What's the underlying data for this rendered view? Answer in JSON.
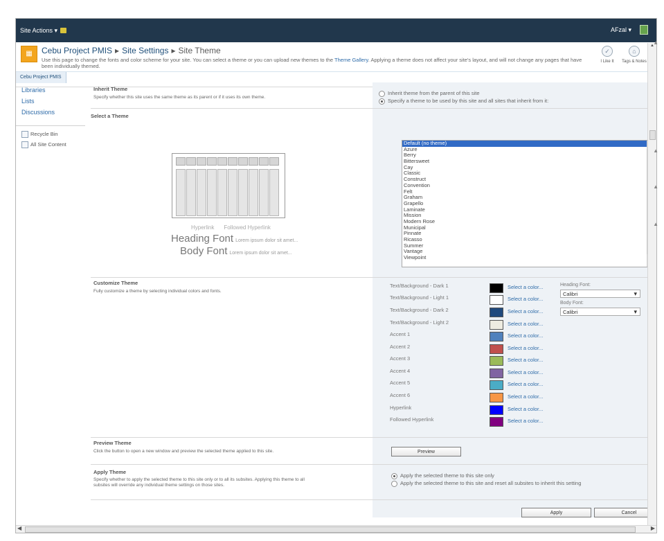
{
  "topbar": {
    "site_actions": "Site Actions ▾",
    "user": "AFzal ▾"
  },
  "header": {
    "breadcrumb": [
      "Cebu Project PMIS",
      "Site Settings",
      "Site Theme"
    ],
    "description_before": "Use this page to change the fonts and color scheme for your site. You can select a theme or you can upload new themes to the ",
    "gallery_link": "Theme Gallery",
    "description_after": ". Applying a theme does not affect your site's layout, and will not change any pages that have been individually themed.",
    "like_label": "I Like It",
    "tags_label": "Tags & Notes",
    "tab": "Cebu Project PMIS"
  },
  "sidebar": {
    "links": [
      "Libraries",
      "Lists",
      "Discussions"
    ],
    "utilities": [
      "Recycle Bin",
      "All Site Content"
    ]
  },
  "sections": {
    "inherit": {
      "title": "Inherit Theme",
      "desc": "Specify whether this site uses the same theme as its parent or if it uses its own theme.",
      "options": [
        "Inherit theme from the parent of this site",
        "Specify a theme to be used by this site and all sites that inherit from it:"
      ]
    },
    "select": {
      "title": "Select a Theme",
      "themes": [
        "Default (no theme)",
        "Azure",
        "Berry",
        "Bittersweet",
        "Cay",
        "Classic",
        "Construct",
        "Convention",
        "Felt",
        "Graham",
        "Grapello",
        "Laminate",
        "Mission",
        "Modern Rose",
        "Municipal",
        "Pinnate",
        "Ricasso",
        "Summer",
        "Vantage",
        "Viewpoint"
      ],
      "preview_hyperlink": "Hyperlink",
      "preview_followed": "Followed Hyperlink",
      "heading_font": "Heading Font",
      "body_font": "Body Font",
      "lorem": "Lorem ipsum dolor sit amet..."
    },
    "customize": {
      "title": "Customize Theme",
      "desc": "Fully customize a theme by selecting individual colors and fonts.",
      "select_link": "Select a color...",
      "colors": [
        {
          "label": "Text/Background - Dark 1",
          "color": "#000000"
        },
        {
          "label": "Text/Background - Light 1",
          "color": "#ffffff"
        },
        {
          "label": "Text/Background - Dark 2",
          "color": "#1f497d"
        },
        {
          "label": "Text/Background - Light 2",
          "color": "#eeece1"
        },
        {
          "label": "Accent 1",
          "color": "#4f81bd"
        },
        {
          "label": "Accent 2",
          "color": "#c0504d"
        },
        {
          "label": "Accent 3",
          "color": "#9bbb59"
        },
        {
          "label": "Accent 4",
          "color": "#8064a2"
        },
        {
          "label": "Accent 5",
          "color": "#4bacc6"
        },
        {
          "label": "Accent 6",
          "color": "#f79646"
        },
        {
          "label": "Hyperlink",
          "color": "#0000ff"
        },
        {
          "label": "Followed Hyperlink",
          "color": "#800080"
        }
      ],
      "heading_font_label": "Heading Font:",
      "heading_font_value": "Calibri",
      "body_font_label": "Body Font:",
      "body_font_value": "Calibri"
    },
    "preview": {
      "title": "Preview Theme",
      "desc": "Click the button to open a new window and preview the selected theme applied to this site.",
      "button": "Preview"
    },
    "apply": {
      "title": "Apply Theme",
      "desc": "Specify whether to apply the selected theme to this site only or to all its subsites. Applying this theme to all subsites will override any individual theme settings on those sites.",
      "options": [
        "Apply the selected theme to this site only",
        "Apply the selected theme to this site and reset all subsites to inherit this setting"
      ]
    }
  },
  "actions": {
    "apply": "Apply",
    "cancel": "Cancel"
  }
}
